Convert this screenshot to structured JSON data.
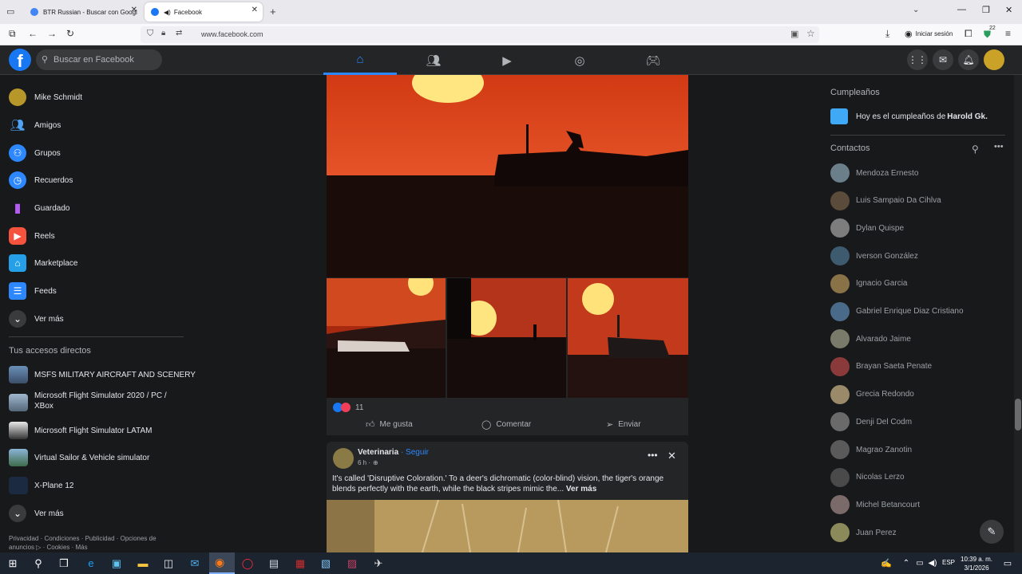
{
  "browser": {
    "tabs": [
      {
        "title": "BTR Russian - Buscar con Googl",
        "active": false
      },
      {
        "title": "Facebook",
        "active": true
      }
    ],
    "url": "www.facebook.com",
    "signin_label": "Iniciar sesión",
    "ext_badge": "22"
  },
  "header": {
    "search_placeholder": "Buscar en Facebook"
  },
  "sidebar": {
    "user": "Mike Schmidt",
    "items": [
      "Amigos",
      "Grupos",
      "Recuerdos",
      "Guardado",
      "Reels",
      "Marketplace",
      "Feeds"
    ],
    "see_more": "Ver más",
    "shortcuts_title": "Tus accesos directos",
    "shortcuts": [
      "MSFS MILITARY AIRCRAFT AND SCENERY",
      "Microsoft Flight Simulator 2020 / PC / XBox",
      "Microsoft Flight Simulator LATAM",
      "Virtual Sailor & Vehicle simulator",
      "X-Plane 12"
    ],
    "see_more_2": "Ver más",
    "footer_line1": "Privacidad · Condiciones · Publicidad · Opciones de",
    "footer_line2": "anuncios ▷ · Cookies · Más"
  },
  "feed": {
    "post1": {
      "reaction_count": "11",
      "like": "Me gusta",
      "comment": "Comentar",
      "send": "Enviar"
    },
    "post2": {
      "author": "Veterinaria",
      "follow": "· Seguir",
      "time": "6 h ·",
      "text": "It's called 'Disruptive Coloration.' To a deer's dichromatic (color-blind) vision, the tiger's orange blends perfectly with the earth, while the black stripes mimic the...",
      "see_more": "Ver más"
    }
  },
  "right": {
    "birthdays_title": "Cumpleaños",
    "birthday_prefix": "Hoy es el cumpleaños de ",
    "birthday_name": "Harold Gk.",
    "contacts_title": "Contactos",
    "contacts": [
      "Mendoza Ernesto",
      "Luis Sampaio Da Cihlva",
      "Dylan Quispe",
      "Iverson González",
      "Ignacio Garcia",
      "Gabriel Enrique Diaz Cristiano",
      "Alvarado Jaime",
      "Brayan Saeta Penate",
      "Grecia Redondo",
      "Denji Del Codm",
      "Magrao Zanotin",
      "Nicolas Lerzo",
      "Michel Betancourt",
      "Juan Perez"
    ]
  },
  "taskbar": {
    "lang": "ESP",
    "time": "10:39 a. m.",
    "date": "3/1/2026"
  },
  "colors": {
    "fb_blue": "#1877f2",
    "bg": "#18191a",
    "card": "#242526"
  }
}
